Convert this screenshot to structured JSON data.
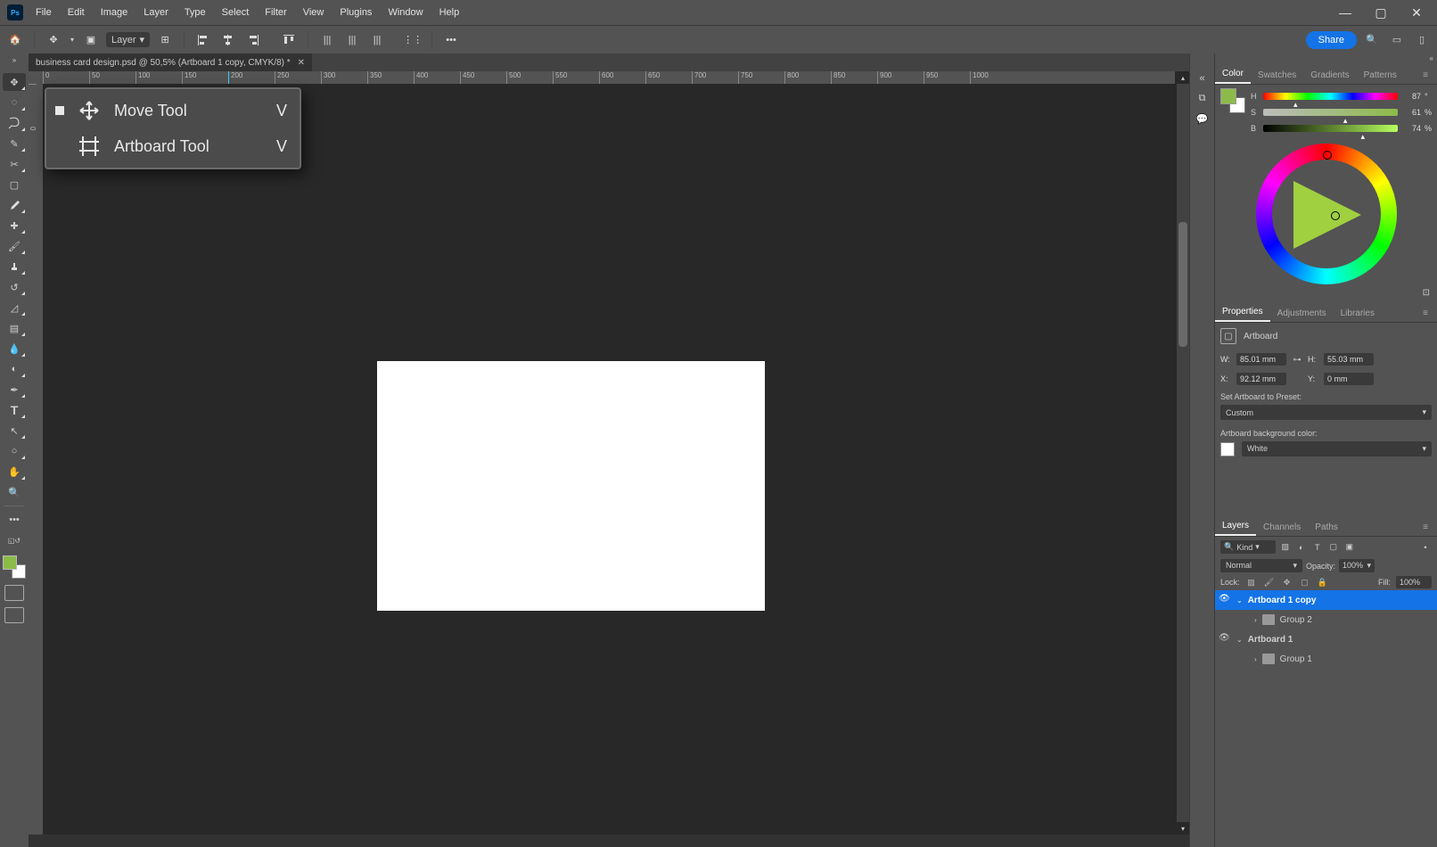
{
  "app": {
    "short": "Ps"
  },
  "menubar": [
    "File",
    "Edit",
    "Image",
    "Layer",
    "Type",
    "Select",
    "Filter",
    "View",
    "Plugins",
    "Window",
    "Help"
  ],
  "options": {
    "mode_label": "Layer",
    "share": "Share"
  },
  "tab": {
    "title": "business card design.psd @ 50,5% (Artboard 1 copy, CMYK/8) *"
  },
  "ruler": {
    "h": [
      "0",
      "50",
      "100",
      "150",
      "200",
      "250",
      "300",
      "350",
      "400",
      "450",
      "500",
      "550",
      "600",
      "650",
      "700",
      "750",
      "800",
      "850",
      "900",
      "950",
      "1000"
    ],
    "v": [
      "0",
      "",
      "",
      "",
      "",
      "",
      "",
      "",
      "",
      "",
      "",
      "",
      "",
      "",
      "",
      ""
    ]
  },
  "tool_menu": {
    "items": [
      {
        "label": "Move Tool",
        "shortcut": "V"
      },
      {
        "label": "Artboard Tool",
        "shortcut": "V"
      }
    ]
  },
  "color": {
    "tabs": [
      "Color",
      "Swatches",
      "Gradients",
      "Patterns"
    ],
    "hsb": {
      "h": 87,
      "s": 61,
      "b": 74
    },
    "fg": "#8cbb49"
  },
  "properties": {
    "tabs": [
      "Properties",
      "Adjustments",
      "Libraries"
    ],
    "type": "Artboard",
    "w": "85.01 mm",
    "h": "55.03 mm",
    "x": "92.12 mm",
    "y": "0 mm",
    "preset_label": "Set Artboard to Preset:",
    "preset": "Custom",
    "bg_label": "Artboard background color:",
    "bg": "White"
  },
  "layers": {
    "tabs": [
      "Layers",
      "Channels",
      "Paths"
    ],
    "filter": "Kind",
    "blend": "Normal",
    "opacity_label": "Opacity:",
    "opacity": "100%",
    "lock_label": "Lock:",
    "fill_label": "Fill:",
    "fill": "100%",
    "list": [
      {
        "eye": true,
        "expanded": true,
        "name": "Artboard 1 copy",
        "bold": true,
        "selected": true,
        "indent": 0
      },
      {
        "eye": false,
        "expanded": false,
        "name": "Group 2",
        "folder": true,
        "indent": 1
      },
      {
        "eye": true,
        "expanded": true,
        "name": "Artboard 1",
        "bold": true,
        "indent": 0
      },
      {
        "eye": false,
        "expanded": false,
        "name": "Group 1",
        "folder": true,
        "indent": 1
      }
    ]
  }
}
